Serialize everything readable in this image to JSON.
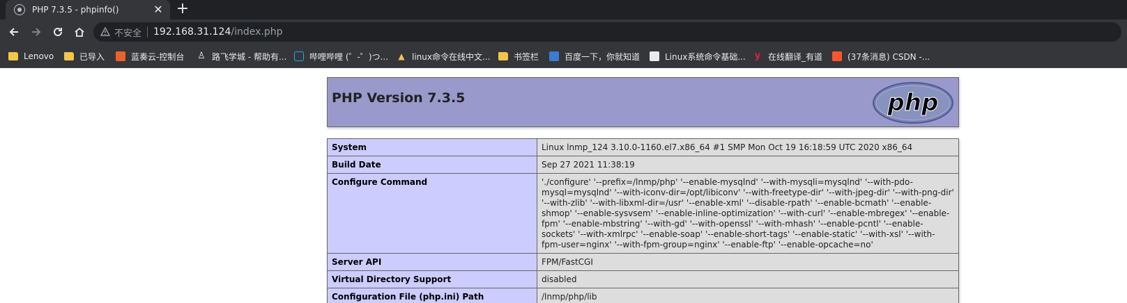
{
  "browser": {
    "tab_title": "PHP 7.3.5 - phpinfo()",
    "tab_close": "✕",
    "new_tab": "+",
    "security_label": "不安全",
    "url_host": "192.168.31.124",
    "url_path": "/index.php"
  },
  "bookmarks": [
    {
      "label": "Lenovo",
      "icon": "folder-icon"
    },
    {
      "label": "已导入",
      "icon": "folder-icon"
    },
    {
      "label": "蓝奏云-控制台",
      "icon": "lanzou-icon"
    },
    {
      "label": "路飞学城 - 帮助有...",
      "icon": "luffy-icon"
    },
    {
      "label": "哔哩哔哩 (゜-゜)つ...",
      "icon": "bilibili-icon"
    },
    {
      "label": "linux命令在线中文...",
      "icon": "linux-icon"
    },
    {
      "label": "书签栏",
      "icon": "folder-icon"
    },
    {
      "label": "百度一下，你就知道",
      "icon": "baidu-icon"
    },
    {
      "label": "Linux系统命令基础...",
      "icon": "linux-book-icon"
    },
    {
      "label": "在线翻译_有道",
      "icon": "youdao-icon"
    },
    {
      "label": "(37条消息) CSDN -...",
      "icon": "csdn-icon"
    }
  ],
  "phpinfo": {
    "version_title": "PHP Version 7.3.5",
    "logo_text": "php",
    "rows": [
      {
        "key": "System",
        "value": "Linux lnmp_124 3.10.0-1160.el7.x86_64 #1 SMP Mon Oct 19 16:18:59 UTC 2020 x86_64"
      },
      {
        "key": "Build Date",
        "value": "Sep 27 2021 11:38:19"
      },
      {
        "key": "Configure Command",
        "value": "'./configure' '--prefix=/lnmp/php' '--enable-mysqlnd' '--with-mysqli=mysqlnd' '--with-pdo-mysql=mysqlnd' '--with-iconv-dir=/opt/libiconv' '--with-freetype-dir' '--with-jpeg-dir' '--with-png-dir' '--with-zlib' '--with-libxml-dir=/usr' '--enable-xml' '--disable-rpath' '--enable-bcmath' '--enable-shmop' '--enable-sysvsem' '--enable-inline-optimization' '--with-curl' '--enable-mbregex' '--enable-fpm' '--enable-mbstring' '--with-gd' '--with-openssl' '--with-mhash' '--enable-pcntl' '--enable-sockets' '--with-xmlrpc' '--enable-soap' '--enable-short-tags' '--enable-static' '--with-xsl' '--with-fpm-user=nginx' '--with-fpm-group=nginx' '--enable-ftp' '--enable-opcache=no'"
      },
      {
        "key": "Server API",
        "value": "FPM/FastCGI"
      },
      {
        "key": "Virtual Directory Support",
        "value": "disabled"
      },
      {
        "key": "Configuration File (php.ini) Path",
        "value": "/lnmp/php/lib"
      }
    ]
  }
}
